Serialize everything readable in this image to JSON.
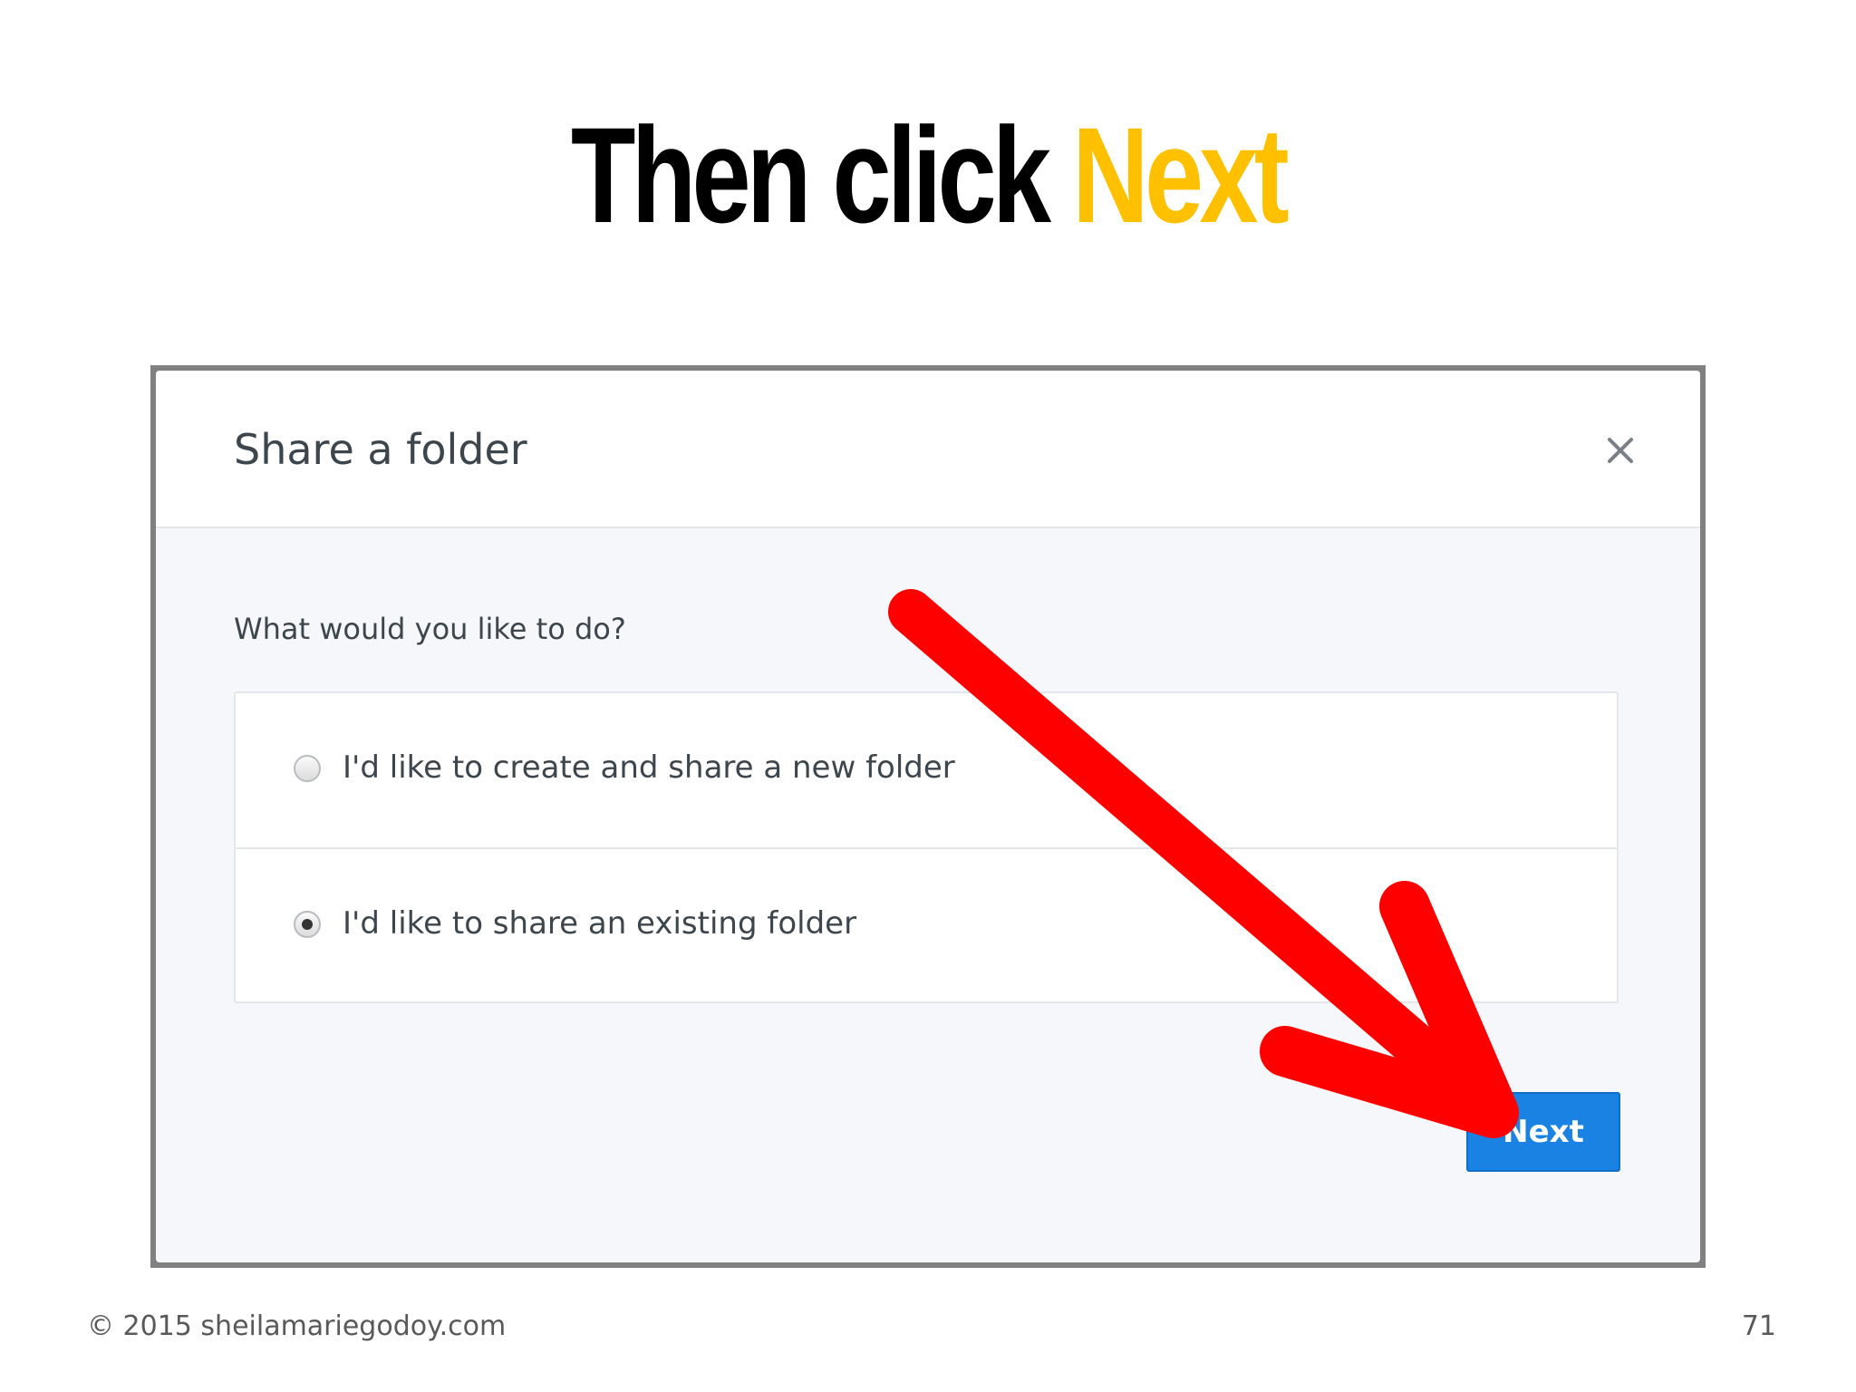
{
  "slide": {
    "title_main": "Then click",
    "title_accent": "Next",
    "accent_color": "#ffc000"
  },
  "dialog": {
    "title": "Share a folder",
    "close_icon": "close-icon",
    "question": "What would you like to do?",
    "options": [
      {
        "label": "I'd like to create and share a new folder",
        "checked": false
      },
      {
        "label": "I'd like to share an existing folder",
        "checked": true
      }
    ],
    "next_label": "Next",
    "primary_color": "#1a82e2"
  },
  "annotation": {
    "arrow_icon": "red-arrow-icon",
    "arrow_color": "#ff0000"
  },
  "footer": {
    "copyright": "© 2015 sheilamariegodoy.com",
    "page_number": "71"
  }
}
